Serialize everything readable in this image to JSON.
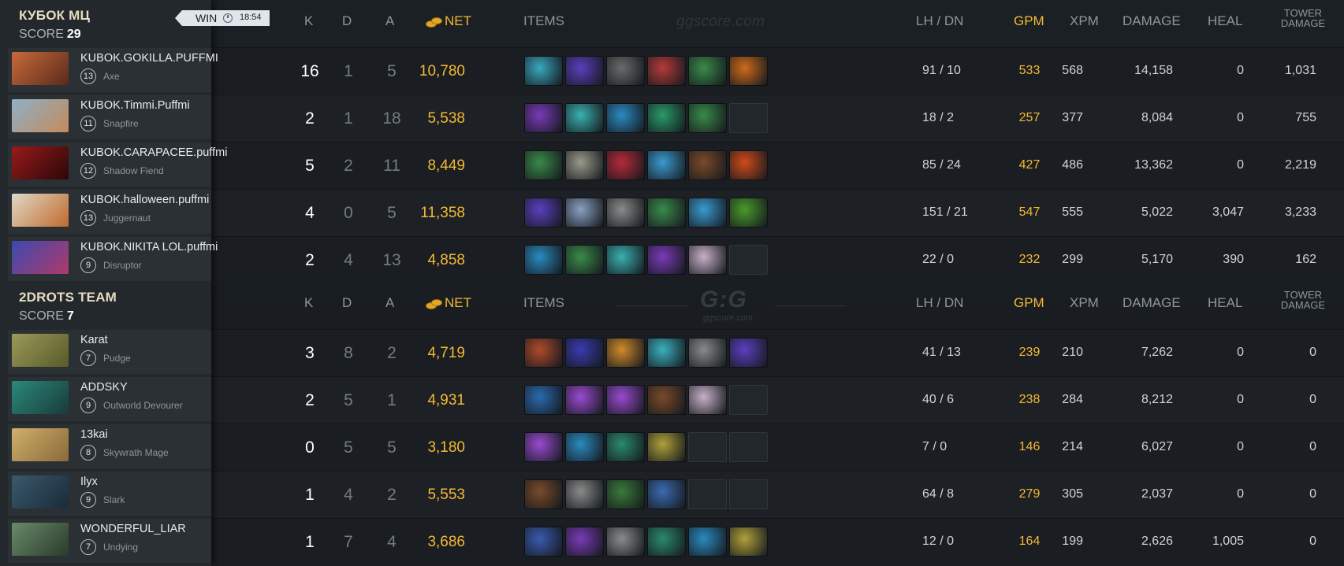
{
  "team1": {
    "name": "КУБОК МЦ",
    "score_label": "SCORE",
    "score": "29",
    "result": "WIN",
    "duration": "18:54",
    "header": {
      "k": "K",
      "d": "D",
      "a": "A",
      "net": "NET",
      "items": "ITEMS",
      "lhdn": "LH  /  DN",
      "gpm": "GPM",
      "xpm": "XPM",
      "damage": "DAMAGE",
      "heal": "HEAL",
      "tower1": "TOWER",
      "tower2": "DAMAGE",
      "watermark": "ggscore.com"
    },
    "players": [
      {
        "name": "KUBOK.GOKILLA.PUFFMI",
        "level": "13",
        "hero": "Axe",
        "k": "16",
        "d": "1",
        "a": "5",
        "net": "10,780",
        "lhdn": "91  /  10",
        "gpm": "533",
        "xpm": "568",
        "damage": "14,158",
        "heal": "0",
        "tower": "1,031",
        "portrait": [
          "#c86a3a",
          "#5a2a1c"
        ],
        "items": [
          "#3aa7c0",
          "#5b3fbf",
          "#6a6a6a",
          "#b53a3a",
          "#3a8a4a",
          "#d06a1a"
        ]
      },
      {
        "name": "KUBOK.Timmi.Puffmi",
        "level": "11",
        "hero": "Snapfire",
        "k": "2",
        "d": "1",
        "a": "18",
        "net": "5,538",
        "lhdn": "18  /  2",
        "gpm": "257",
        "xpm": "377",
        "damage": "8,084",
        "heal": "0",
        "tower": "755",
        "portrait": [
          "#8fb0c8",
          "#c48a5a"
        ],
        "items": [
          "#7a3ab8",
          "#3ab0b0",
          "#2a8ac0",
          "#2a9a6a",
          "#3a8a4a",
          ""
        ]
      },
      {
        "name": "KUBOK.CARAPACEE.puffmi",
        "level": "12",
        "hero": "Shadow Fiend",
        "k": "5",
        "d": "2",
        "a": "11",
        "net": "8,449",
        "lhdn": "85  /  24",
        "gpm": "427",
        "xpm": "486",
        "damage": "13,362",
        "heal": "0",
        "tower": "2,219",
        "portrait": [
          "#9a1a1a",
          "#2a0808"
        ],
        "items": [
          "#3a8a4a",
          "#9a9a8a",
          "#b52a3a",
          "#3a9ad0",
          "#7a4a2a",
          "#d04a1a"
        ]
      },
      {
        "name": "KUBOK.halloween.puffmi",
        "level": "13",
        "hero": "Juggernaut",
        "k": "4",
        "d": "0",
        "a": "5",
        "net": "11,358",
        "lhdn": "151  /  21",
        "gpm": "547",
        "xpm": "555",
        "damage": "5,022",
        "heal": "3,047",
        "tower": "3,233",
        "portrait": [
          "#e0d8c8",
          "#c06a2a"
        ],
        "items": [
          "#5b3fbf",
          "#8aa0c0",
          "#8a8a8a",
          "#3a8a4a",
          "#3a9ad0",
          "#4a9a2a"
        ]
      },
      {
        "name": "KUBOK.NIKITA LOL.puffmi",
        "level": "9",
        "hero": "Disruptor",
        "k": "2",
        "d": "4",
        "a": "13",
        "net": "4,858",
        "lhdn": "22  /  0",
        "gpm": "232",
        "xpm": "299",
        "damage": "5,170",
        "heal": "390",
        "tower": "162",
        "portrait": [
          "#3a4ab0",
          "#b03a6a"
        ],
        "items": [
          "#2a8ac0",
          "#3a8a4a",
          "#3ab0b0",
          "#7a3ab8",
          "#c8b0c8",
          ""
        ]
      }
    ]
  },
  "team2": {
    "name": "2DROTS TEAM",
    "score_label": "SCORE",
    "score": "7",
    "header": {
      "k": "K",
      "d": "D",
      "a": "A",
      "net": "NET",
      "items": "ITEMS",
      "lhdn": "LH  /  DN",
      "gpm": "GPM",
      "xpm": "XPM",
      "damage": "DAMAGE",
      "heal": "HEAL",
      "tower1": "TOWER",
      "tower2": "DAMAGE",
      "logo": "G:G",
      "logo_sub": "ggscore.com"
    },
    "players": [
      {
        "name": "Karat",
        "level": "7",
        "hero": "Pudge",
        "k": "3",
        "d": "8",
        "a": "2",
        "net": "4,719",
        "lhdn": "41  /  13",
        "gpm": "239",
        "xpm": "210",
        "damage": "7,262",
        "heal": "0",
        "tower": "0",
        "portrait": [
          "#9a9a5a",
          "#5a5a2a"
        ],
        "items": [
          "#b04a2a",
          "#3a3ab0",
          "#d08a2a",
          "#3ab0c0",
          "#8a8a8a",
          "#5b3fbf"
        ]
      },
      {
        "name": "ADDSKY",
        "level": "9",
        "hero": "Outworld Devourer",
        "k": "2",
        "d": "5",
        "a": "1",
        "net": "4,931",
        "lhdn": "40  /  6",
        "gpm": "238",
        "xpm": "284",
        "damage": "8,212",
        "heal": "0",
        "tower": "0",
        "portrait": [
          "#2a8a7a",
          "#1a3a3a"
        ],
        "items": [
          "#2a6ab0",
          "#9a4ad0",
          "#9a4ad0",
          "#7a4a2a",
          "#c8b0c8",
          ""
        ]
      },
      {
        "name": "13kai",
        "level": "8",
        "hero": "Skywrath Mage",
        "k": "0",
        "d": "5",
        "a": "5",
        "net": "3,180",
        "lhdn": "7  /  0",
        "gpm": "146",
        "xpm": "214",
        "damage": "6,027",
        "heal": "0",
        "tower": "0",
        "portrait": [
          "#d0b06a",
          "#8a6a3a"
        ],
        "items": [
          "#9a4ad0",
          "#2a8ac0",
          "#2a8a6a",
          "#b0a03a",
          "",
          ""
        ]
      },
      {
        "name": "Ilyx",
        "level": "9",
        "hero": "Slark",
        "k": "1",
        "d": "4",
        "a": "2",
        "net": "5,553",
        "lhdn": "64  /  8",
        "gpm": "279",
        "xpm": "305",
        "damage": "2,037",
        "heal": "0",
        "tower": "0",
        "portrait": [
          "#3a5a6a",
          "#1a2a3a"
        ],
        "items": [
          "#7a4a2a",
          "#8a8a8a",
          "#3a7a3a",
          "#3a6ab0",
          "",
          ""
        ]
      },
      {
        "name": "WONDERFUL_LIAR",
        "level": "7",
        "hero": "Undying",
        "k": "1",
        "d": "7",
        "a": "4",
        "net": "3,686",
        "lhdn": "12  /  0",
        "gpm": "164",
        "xpm": "199",
        "damage": "2,626",
        "heal": "1,005",
        "tower": "0",
        "portrait": [
          "#6a8a6a",
          "#2a3a2a"
        ],
        "items": [
          "#3a5ab0",
          "#7a3ab8",
          "#8a8a8a",
          "#2a8a6a",
          "#2a8ac0",
          "#b0a03a"
        ]
      }
    ]
  }
}
